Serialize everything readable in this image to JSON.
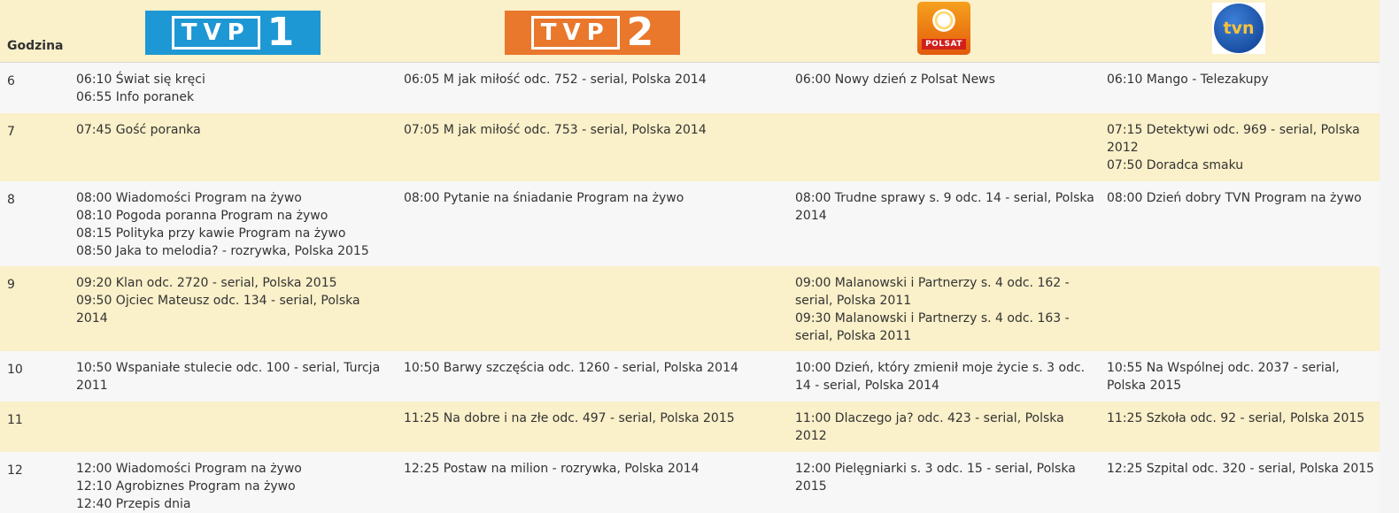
{
  "header": {
    "hour_label": "Godzina",
    "channels": {
      "tvp1": {
        "logo_text": "TVP",
        "logo_number": "1"
      },
      "tvp2": {
        "logo_text": "TVP",
        "logo_number": "2"
      },
      "polsat": {
        "logo_text": "POLSAT"
      },
      "tvn": {
        "logo_text": "tvn"
      }
    }
  },
  "colors": {
    "header_bg": "#faf0c9",
    "row_alt_bg": "#faf0c9",
    "row_bg": "#f7f7f7",
    "tvp1": "#1d98d4",
    "tvp2": "#e9772c",
    "polsat": "#e8721a",
    "tvn": "#0b3c8c"
  },
  "rows": [
    {
      "hour": "6",
      "tvp1": [
        "06:10 Świat się kręci",
        "06:55 Info poranek"
      ],
      "tvp2": [
        "06:05 M jak miłość odc. 752 - serial, Polska 2014"
      ],
      "polsat": [
        "06:00 Nowy dzień z Polsat News"
      ],
      "tvn": [
        "06:10 Mango - Telezakupy"
      ]
    },
    {
      "hour": "7",
      "tvp1": [
        "07:45 Gość poranka"
      ],
      "tvp2": [
        "07:05 M jak miłość odc. 753 - serial, Polska 2014"
      ],
      "polsat": [],
      "tvn": [
        "07:15 Detektywi odc. 969 - serial, Polska 2012",
        "07:50 Doradca smaku"
      ]
    },
    {
      "hour": "8",
      "tvp1": [
        "08:00 Wiadomości Program na żywo",
        "08:10 Pogoda poranna Program na żywo",
        "08:15 Polityka przy kawie Program na żywo",
        "08:50 Jaka to melodia? - rozrywka, Polska 2015"
      ],
      "tvp2": [
        "08:00 Pytanie na śniadanie Program na żywo"
      ],
      "polsat": [
        "08:00 Trudne sprawy s. 9 odc. 14 - serial, Polska 2014"
      ],
      "tvn": [
        "08:00 Dzień dobry TVN Program na żywo"
      ]
    },
    {
      "hour": "9",
      "tvp1": [
        "09:20 Klan odc. 2720 - serial, Polska 2015",
        "09:50 Ojciec Mateusz odc. 134 - serial, Polska 2014"
      ],
      "tvp2": [],
      "polsat": [
        "09:00 Malanowski i Partnerzy s. 4 odc. 162 - serial, Polska 2011",
        "09:30 Malanowski i Partnerzy s. 4 odc. 163 - serial, Polska 2011"
      ],
      "tvn": []
    },
    {
      "hour": "10",
      "tvp1": [
        "10:50 Wspaniałe stulecie odc. 100 - serial, Turcja 2011"
      ],
      "tvp2": [
        "10:50 Barwy szczęścia odc. 1260 - serial, Polska 2014"
      ],
      "polsat": [
        "10:00 Dzień, który zmienił moje życie s. 3 odc. 14 - serial, Polska 2014"
      ],
      "tvn": [
        "10:55 Na Wspólnej odc. 2037 - serial, Polska 2015"
      ]
    },
    {
      "hour": "11",
      "tvp1": [],
      "tvp2": [
        "11:25 Na dobre i na złe odc. 497 - serial, Polska 2015"
      ],
      "polsat": [
        "11:00 Dlaczego ja? odc. 423 - serial, Polska 2012"
      ],
      "tvn": [
        "11:25 Szkoła odc. 92 - serial, Polska 2015"
      ]
    },
    {
      "hour": "12",
      "tvp1": [
        "12:00 Wiadomości Program na żywo",
        "12:10 Agrobiznes Program na żywo",
        "12:40 Przepis dnia"
      ],
      "tvp2": [
        "12:25 Postaw na milion - rozrywka, Polska 2014"
      ],
      "polsat": [
        "12:00 Pielęgniarki s. 3 odc. 15 - serial, Polska 2015"
      ],
      "tvn": [
        "12:25 Szpital odc. 320 - serial, Polska 2015"
      ]
    }
  ]
}
